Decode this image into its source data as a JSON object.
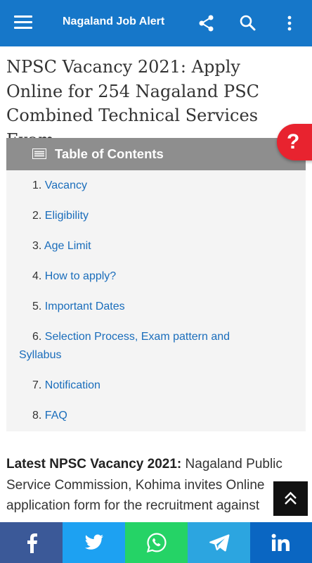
{
  "appbar": {
    "title": "Nagaland Job Alert",
    "icons": [
      "menu-icon",
      "share-icon",
      "search-icon",
      "more-vert-icon"
    ],
    "color": "#1677c9"
  },
  "article": {
    "title": "NPSC Vacancy 2021: Apply Online for 254 Nagaland PSC Combined Technical Services Exam"
  },
  "help_badge": {
    "label": "?",
    "color": "#e8232f"
  },
  "toc": {
    "heading": "Table of Contents",
    "items": [
      {
        "num": "1.",
        "label": "Vacancy"
      },
      {
        "num": "2.",
        "label": "Eligibility"
      },
      {
        "num": "3.",
        "label": "Age Limit"
      },
      {
        "num": "4.",
        "label": "How to apply?"
      },
      {
        "num": "5.",
        "label": "Important Dates"
      },
      {
        "num": "6.",
        "label": "Selection Process, Exam pattern and Syllabus"
      },
      {
        "num": "7.",
        "label": "Notification"
      },
      {
        "num": "8.",
        "label": "FAQ"
      }
    ]
  },
  "body": {
    "lead_bold": "Latest NPSC Vacancy 2021:",
    "lead_text": " Nagaland Public Service Commission, Kohima invites Online application form for the recruitment against"
  },
  "share_bar": [
    {
      "name": "facebook",
      "icon": "facebook-icon",
      "color": "#3b5998"
    },
    {
      "name": "twitter",
      "icon": "twitter-icon",
      "color": "#1da1f2"
    },
    {
      "name": "whatsapp",
      "icon": "whatsapp-icon",
      "color": "#25d366"
    },
    {
      "name": "telegram",
      "icon": "telegram-icon",
      "color": "#2ca5e0"
    },
    {
      "name": "linkedin",
      "icon": "linkedin-icon",
      "color": "#0a66c2"
    }
  ]
}
